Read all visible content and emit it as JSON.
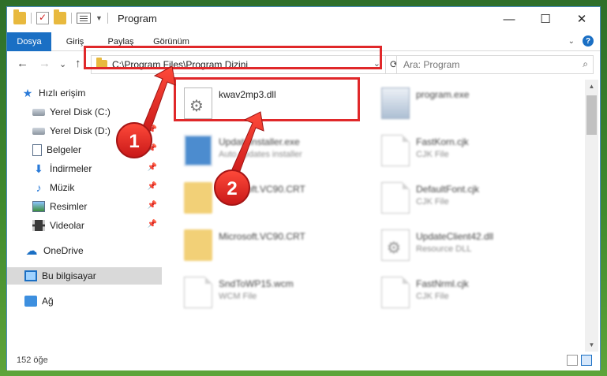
{
  "title": "Program",
  "ribbon": {
    "tabs": [
      {
        "label": "Dosya",
        "active": true
      },
      {
        "label": "Giriş",
        "active": false
      },
      {
        "label": "Paylaş",
        "active": false
      },
      {
        "label": "Görünüm",
        "active": false
      }
    ],
    "help": "?"
  },
  "window_controls": {
    "minimize": "—",
    "maximize": "☐",
    "close": "✕"
  },
  "navbar": {
    "back": "←",
    "forward": "→",
    "recent": "⌄",
    "up": "↑",
    "address": "C:\\Program Files\\Program Dizini",
    "search_placeholder": "Ara: Program"
  },
  "sidebar": {
    "quick_access": "Hızlı erişim",
    "items": [
      {
        "label": "Yerel Disk (C:)"
      },
      {
        "label": "Yerel Disk (D:)"
      },
      {
        "label": "Belgeler"
      },
      {
        "label": "İndirmeler"
      },
      {
        "label": "Müzik"
      },
      {
        "label": "Resimler"
      },
      {
        "label": "Videolar"
      }
    ],
    "onedrive": "OneDrive",
    "this_pc": "Bu bilgisayar",
    "network": "Ağ"
  },
  "files": [
    {
      "name": "kwav2mp3.dll",
      "type": "",
      "icon": "dll-gear-icon"
    },
    {
      "name": "program.exe",
      "type": "",
      "icon": "exe-icon"
    },
    {
      "name": "UpdateInstaller.exe",
      "type": "Auto updates installer",
      "icon": "installer-icon"
    },
    {
      "name": "FastKorn.cjk",
      "type": "CJK File",
      "icon": "file-icon"
    },
    {
      "name": "Microsoft.VC90.CRT",
      "type": "",
      "icon": "folder-icon"
    },
    {
      "name": "DefaultFont.cjk",
      "type": "CJK File",
      "icon": "file-icon"
    },
    {
      "name": "Microsoft.VC90.CRT",
      "type": "",
      "icon": "folder-icon"
    },
    {
      "name": "UpdateClient42.dll",
      "type": "Resource DLL",
      "icon": "dll-gear-icon"
    },
    {
      "name": "SndToWP15.wcm",
      "type": "WCM File",
      "icon": "file-icon"
    },
    {
      "name": "FastNrml.cjk",
      "type": "CJK File",
      "icon": "file-icon"
    }
  ],
  "status": {
    "count": "152 öğe"
  },
  "annotations": {
    "step1": "1",
    "step2": "2",
    "color": "#e0282a"
  }
}
